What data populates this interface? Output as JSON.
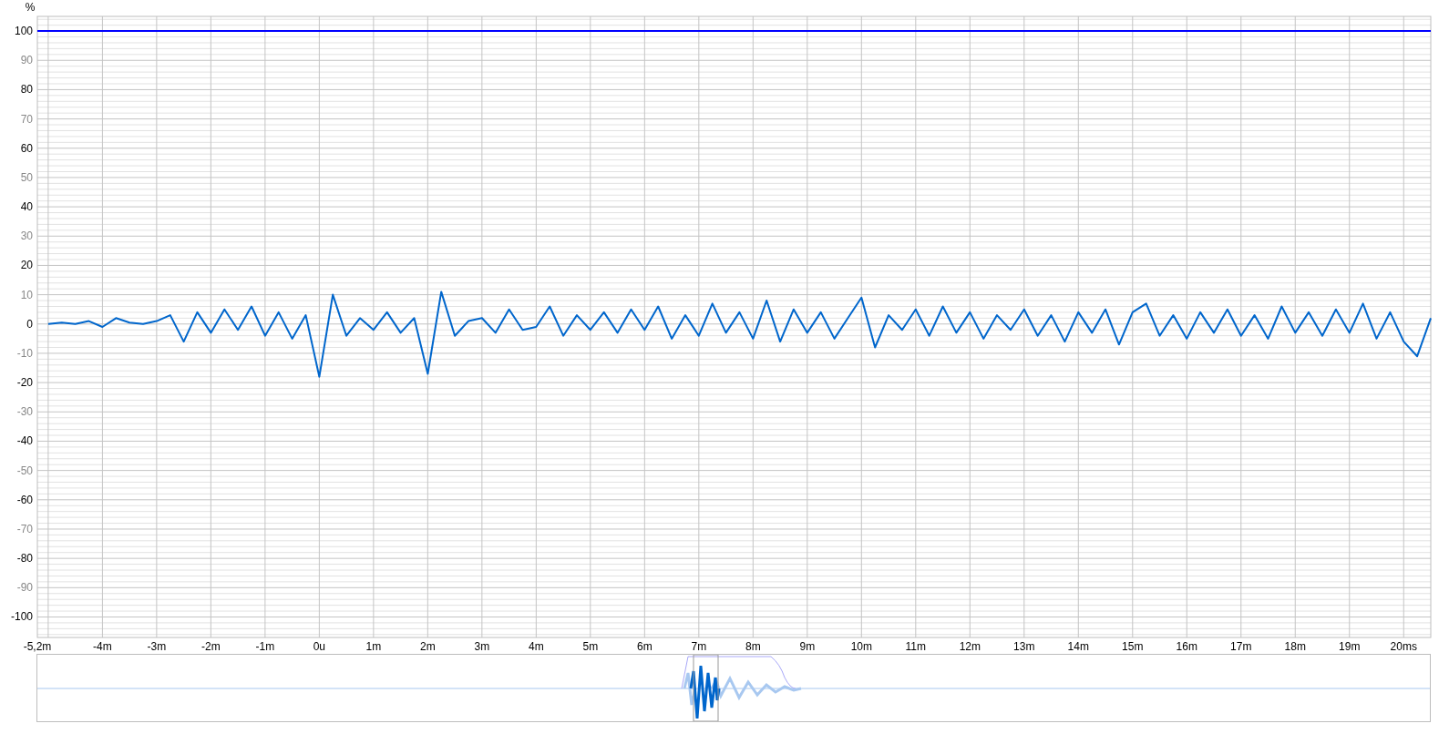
{
  "chart": {
    "chart_data": {
      "type": "line",
      "ylabel": "%",
      "xlim": [
        -5.2,
        20.5
      ],
      "ylim": [
        -107,
        105
      ],
      "xticks": [
        {
          "value": -5.2,
          "label": "-5,2m"
        },
        {
          "value": -4,
          "label": "-4m"
        },
        {
          "value": -3,
          "label": "-3m"
        },
        {
          "value": -2,
          "label": "-2m"
        },
        {
          "value": -1,
          "label": "-1m"
        },
        {
          "value": 0,
          "label": "0u"
        },
        {
          "value": 1,
          "label": "1m"
        },
        {
          "value": 2,
          "label": "2m"
        },
        {
          "value": 3,
          "label": "3m"
        },
        {
          "value": 4,
          "label": "4m"
        },
        {
          "value": 5,
          "label": "5m"
        },
        {
          "value": 6,
          "label": "6m"
        },
        {
          "value": 7,
          "label": "7m"
        },
        {
          "value": 8,
          "label": "8m"
        },
        {
          "value": 9,
          "label": "9m"
        },
        {
          "value": 10,
          "label": "10m"
        },
        {
          "value": 11,
          "label": "11m"
        },
        {
          "value": 12,
          "label": "12m"
        },
        {
          "value": 13,
          "label": "13m"
        },
        {
          "value": 14,
          "label": "14m"
        },
        {
          "value": 15,
          "label": "15m"
        },
        {
          "value": 16,
          "label": "16m"
        },
        {
          "value": 17,
          "label": "17m"
        },
        {
          "value": 18,
          "label": "18m"
        },
        {
          "value": 19,
          "label": "19m"
        },
        {
          "value": 20,
          "label": "20ms"
        }
      ],
      "yticks": [
        100,
        90,
        80,
        70,
        60,
        50,
        40,
        30,
        20,
        10,
        0,
        -10,
        -20,
        -30,
        -40,
        -50,
        -60,
        -70,
        -80,
        -90,
        -100
      ],
      "x": [
        -5,
        -4.75,
        -4.5,
        -4.25,
        -4,
        -3.75,
        -3.5,
        -3.25,
        -3,
        -2.75,
        -2.5,
        -2.25,
        -2,
        -1.75,
        -1.5,
        -1.25,
        -1,
        -0.75,
        -0.5,
        -0.25,
        0,
        0.25,
        0.5,
        0.75,
        1,
        1.25,
        1.5,
        1.75,
        2,
        2.25,
        2.5,
        2.75,
        3,
        3.25,
        3.5,
        3.75,
        4,
        4.25,
        4.5,
        4.75,
        5,
        5.25,
        5.5,
        5.75,
        6,
        6.25,
        6.5,
        6.75,
        7,
        7.25,
        7.5,
        7.75,
        8,
        8.25,
        8.5,
        8.75,
        9,
        9.25,
        9.5,
        9.75,
        10,
        10.25,
        10.5,
        10.75,
        11,
        11.25,
        11.5,
        11.75,
        12,
        12.25,
        12.5,
        12.75,
        13,
        13.25,
        13.5,
        13.75,
        14,
        14.25,
        14.5,
        14.75,
        15,
        15.25,
        15.5,
        15.75,
        16,
        16.25,
        16.5,
        16.75,
        17,
        17.25,
        17.5,
        17.75,
        18,
        18.25,
        18.5,
        18.75,
        19,
        19.25,
        19.5,
        19.75,
        20,
        20.25,
        20.5
      ],
      "series": [
        {
          "color": "#0066cc",
          "values": [
            0,
            0.5,
            0,
            1,
            -1,
            2,
            0.5,
            0,
            1,
            3,
            -6,
            4,
            -3,
            5,
            -2,
            6,
            -4,
            4,
            -5,
            3,
            -18,
            10,
            -4,
            2,
            -2,
            4,
            -3,
            2,
            -17,
            11,
            -4,
            1,
            2,
            -3,
            5,
            -2,
            -1,
            6,
            -4,
            3,
            -2,
            4,
            -3,
            5,
            -2,
            6,
            -5,
            3,
            -4,
            7,
            -3,
            4,
            -5,
            8,
            -6,
            5,
            -3,
            4,
            -5,
            2,
            9,
            -8,
            3,
            -2,
            5,
            -4,
            6,
            -3,
            4,
            -5,
            3,
            -2,
            5,
            -4,
            3,
            -6,
            4,
            -3,
            5,
            -7,
            4,
            7,
            -4,
            3,
            -5,
            4,
            -3,
            5,
            -4,
            3,
            -5,
            6,
            -3,
            4,
            -4,
            5,
            -3,
            7,
            -5,
            4,
            -6,
            -11,
            2
          ]
        }
      ],
      "grid": true,
      "ref_lines": [
        {
          "axis": "y",
          "value": 100,
          "color": "#0000ff"
        }
      ]
    }
  }
}
